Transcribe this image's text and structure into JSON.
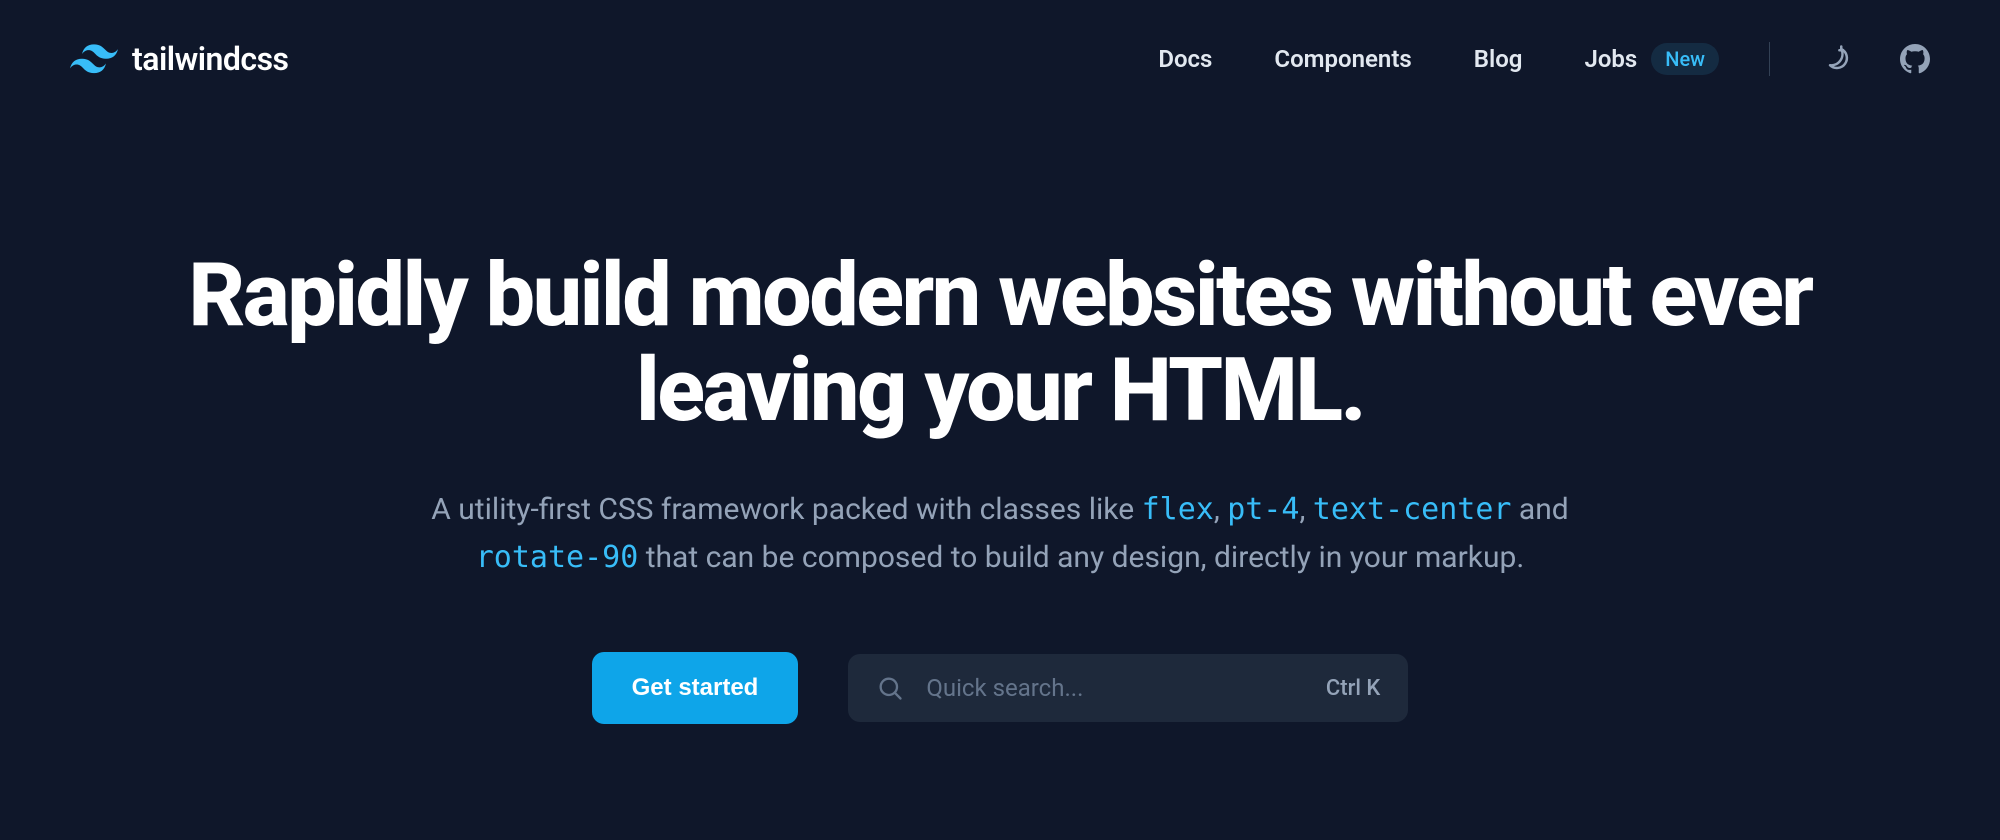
{
  "logo": {
    "text": "tailwindcss"
  },
  "nav": {
    "docs": "Docs",
    "components": "Components",
    "blog": "Blog",
    "jobs": "Jobs",
    "jobs_badge": "New"
  },
  "hero": {
    "title": "Rapidly build modern websites without ever leaving your HTML.",
    "subtitle_part1": "A utility-first CSS framework packed with classes like ",
    "token1": "flex",
    "sep1": ", ",
    "token2": "pt-4",
    "sep2": ", ",
    "token3": "text-center",
    "sep3": " and ",
    "token4": "rotate-90",
    "subtitle_part2": " that can be composed to build any design, directly in your markup."
  },
  "cta": {
    "get_started": "Get started",
    "search_placeholder": "Quick search...",
    "search_shortcut": "Ctrl K"
  }
}
